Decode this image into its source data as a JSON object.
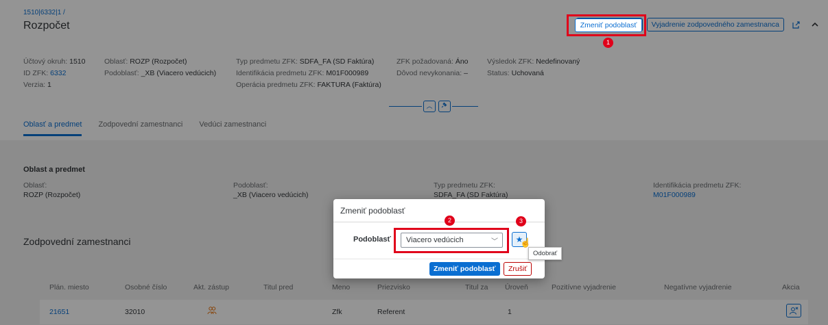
{
  "breadcrumb": "1510|6332|1 /",
  "title": "Rozpočet",
  "header_actions": {
    "change_subarea": "Zmeniť podoblasť",
    "responsible_statement": "Vyjadrenie zodpovedného zamestnanca",
    "share_icon": "share-icon",
    "collapse_icon": "chevron-up-icon"
  },
  "badges": {
    "one": "1",
    "two": "2",
    "three": "3"
  },
  "facets": {
    "col1": [
      {
        "label": "Účtový okruh:",
        "value": "1510"
      },
      {
        "label": "ID ZFK:",
        "value": "6332"
      },
      {
        "label": "Verzia:",
        "value": "1"
      }
    ],
    "col2": [
      {
        "label": "Oblasť:",
        "value": "ROZP (Rozpočet)"
      },
      {
        "label": "Podoblasť:",
        "value": "_XB (Viacero vedúcich)"
      }
    ],
    "col3": [
      {
        "label": "Typ predmetu ZFK:",
        "value": "SDFA_FA (SD Faktúra)"
      },
      {
        "label": "Identifikácia predmetu ZFK:",
        "value": "M01F000989"
      },
      {
        "label": "Operácia predmetu ZFK:",
        "value": "FAKTURA (Faktúra)"
      }
    ],
    "col4": [
      {
        "label": "ZFK požadovaná:",
        "value": "Áno"
      },
      {
        "label": "Dôvod nevykonania:",
        "value": "–"
      }
    ],
    "col5": [
      {
        "label": "Výsledok ZFK:",
        "value": "Nedefinovaný"
      },
      {
        "label": "Status:",
        "value": "Uchovaná"
      }
    ]
  },
  "tabs": [
    "Oblasť a predmet",
    "Zodpovední zamestnanci",
    "Vedúci zamestnanci"
  ],
  "section1": {
    "title": "Oblast a predmet",
    "fields": [
      {
        "label": "Oblasť:",
        "value": "ROZP (Rozpočet)"
      },
      {
        "label": "Podoblasť:",
        "value": "_XB (Viacero vedúcich)"
      },
      {
        "label": "Typ predmetu ZFK:",
        "value": "SDFA_FA (SD Faktúra)"
      },
      {
        "label": "Identifikácia predmetu ZFK:",
        "value": "M01F000989"
      }
    ]
  },
  "section2": {
    "title": "Zodpovední zamestnanci",
    "columns": [
      "Plán. miesto",
      "Osobné číslo",
      "Akt. zástup",
      "Titul pred",
      "Meno",
      "Priezvisko",
      "Titul za",
      "Úroveň",
      "Pozitívne vyjadrenie",
      "Negatívne vyjadrenie",
      "Akcia"
    ],
    "rows": [
      {
        "plan": "21651",
        "osobne": "32010",
        "meno": "Zfk",
        "priezvisko": "Referent",
        "uroven": "1"
      }
    ]
  },
  "dialog": {
    "title": "Zmeniť podoblasť",
    "field_label": "Podoblasť",
    "select_value": "Viacero vedúcich",
    "favorite_tooltip": "Odobrať",
    "confirm": "Zmeniť podoblasť",
    "cancel": "Zrušiť"
  },
  "colors": {
    "accent": "#0a6ed1",
    "highlight": "#e0001a",
    "reject": "#bb0000"
  }
}
